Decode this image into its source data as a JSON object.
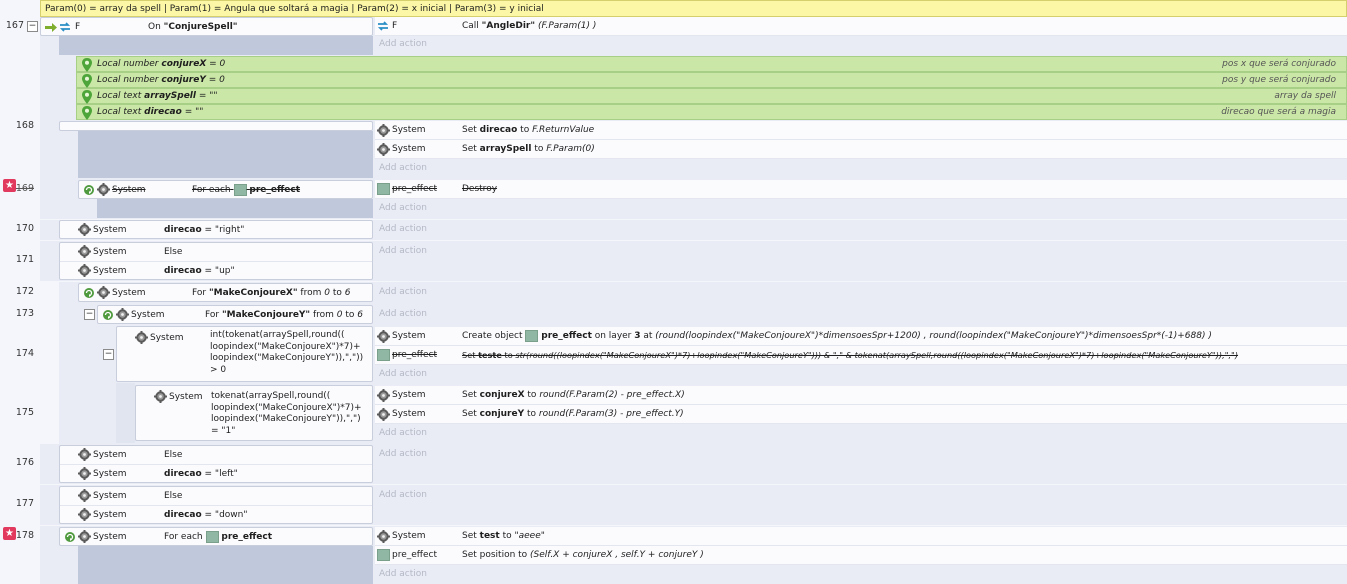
{
  "comment": "Param(0) = array da spell | Param(1) = Angula que soltará a magia | Param(2) = x inicial | Param(3) = y inicial",
  "add_action": "Add action",
  "rows": {
    "r167": {
      "num": "167",
      "cond_obj": "F",
      "cond_text": "On ",
      "cond_bold": "\"ConjureSpell\"",
      "act_obj": "F",
      "act_text": "Call ",
      "act_bold": "\"AngleDir\"",
      "act_rest": "(F.Param(1) )"
    },
    "locals": [
      {
        "kind": "Local number",
        "name": "conjureX",
        "value": " = 0",
        "note": "pos x que será conjurado"
      },
      {
        "kind": "Local number",
        "name": "conjureY",
        "value": " = 0",
        "note": "pos y que será conjurado"
      },
      {
        "kind": "Local text",
        "name": "arraySpell",
        "value": " = \"\"",
        "note": "array da spell"
      },
      {
        "kind": "Local text",
        "name": "direcao",
        "value": " = \"\"",
        "note": "direcao que será a magia"
      }
    ],
    "r168": {
      "num": "168",
      "a1_obj": "System",
      "a1_pre": "Set ",
      "a1_bold": "direcao",
      "a1_mid": " to ",
      "a1_it": "F.ReturnValue",
      "a2_obj": "System",
      "a2_pre": "Set ",
      "a2_bold": "arraySpell",
      "a2_mid": " to ",
      "a2_it": "F.Param(0)"
    },
    "r169": {
      "num": "169",
      "cond_obj": "System",
      "cond_text": "For each",
      "cond_bold": "pre_effect",
      "act_obj": "pre_effect",
      "act_text": "Destroy"
    },
    "r170": {
      "num": "170",
      "cond_obj": "System",
      "cond_bold": "direcao",
      "cond_text": " = \"right\""
    },
    "r171": {
      "num": "171",
      "c1_obj": "System",
      "c1_text": "Else",
      "c2_obj": "System",
      "c2_bold": "direcao",
      "c2_text": " = \"up\""
    },
    "r172": {
      "num": "172",
      "cond_obj": "System",
      "cond_pre": "For ",
      "cond_bold": "\"MakeConjoureX\"",
      "cond_mid": " from ",
      "cond_i1": "0",
      "cond_to": " to ",
      "cond_i2": "6"
    },
    "r173": {
      "num": "173",
      "cond_obj": "System",
      "cond_pre": "For ",
      "cond_bold": "\"MakeConjoureY\"",
      "cond_mid": " from ",
      "cond_i1": "0",
      "cond_to": " to ",
      "cond_i2": "6"
    },
    "r174": {
      "num": "174",
      "cond_obj": "System",
      "cond_lines": [
        "int(tokenat(arraySpell,round((",
        "loopindex(\"MakeConjoureX\")*7)+",
        "loopindex(\"MakeConjoureY\")),\",\"))",
        "> 0"
      ],
      "a1_obj": "System",
      "a1_pre": "Create object ",
      "a1_bold": "pre_effect",
      "a1_mid": " on layer ",
      "a1_layer": "3",
      "a1_at": " at ",
      "a1_expr": "(round(loopindex(\"MakeConjoureX\")*dimensoesSpr+1200)  , round(loopindex(\"MakeConjoureY\")*dimensoesSpr*(-1)+688)    )",
      "a2_obj": "pre_effect",
      "a2_pre": "Set ",
      "a2_bold": "teste",
      "a2_mid": " to ",
      "a2_it": "str(round((loopindex(\"MakeConjoureX\")*7)+loopindex(\"MakeConjoureY\"))) & \",\" & tokenat(arraySpell,round((loopindex(\"MakeConjoureX\")*7)+loopindex(\"MakeConjoureY\")),\",\")"
    },
    "r175": {
      "num": "175",
      "cond_obj": "System",
      "cond_lines": [
        "tokenat(arraySpell,round((",
        "loopindex(\"MakeConjoureX\")*7)+",
        "loopindex(\"MakeConjoureY\")),\",\")",
        "= \"1\""
      ],
      "a1_obj": "System",
      "a1_pre": "Set ",
      "a1_bold": "conjureX",
      "a1_mid": " to ",
      "a1_it": "round(F.Param(2) - pre_effect.X)",
      "a2_obj": "System",
      "a2_pre": "Set ",
      "a2_bold": "conjureY",
      "a2_mid": " to ",
      "a2_it": "round(F.Param(3) - pre_effect.Y)"
    },
    "r176": {
      "num": "176",
      "c1_obj": "System",
      "c1_text": "Else",
      "c2_obj": "System",
      "c2_bold": "direcao",
      "c2_text": " = \"left\""
    },
    "r177": {
      "num": "177",
      "c1_obj": "System",
      "c1_text": "Else",
      "c2_obj": "System",
      "c2_bold": "direcao",
      "c2_text": " = \"down\""
    },
    "r178": {
      "num": "178",
      "cond_obj": "System",
      "cond_text": "For each",
      "cond_bold": "pre_effect",
      "a1_obj": "System",
      "a1_pre": "Set ",
      "a1_bold": "test",
      "a1_mid": " to ",
      "a1_it": "\"aeee\"",
      "a2_obj": "pre_effect",
      "a2_pre": "Set position to ",
      "a2_it": "(Self.X + conjureX , self.Y + conjureY  )"
    }
  },
  "colors": {
    "variable_bg": "#cbe7a8",
    "comment_bg": "#fbf7a6",
    "bookmark": "#e23a5f",
    "indent_pad": "#c0c9dc",
    "sprite": "#8fb7a3"
  },
  "icons": [
    "arrow-right-icon",
    "trigger-icon",
    "gear-icon",
    "loop-icon",
    "sprite-icon",
    "variable-pin-icon",
    "bookmark-icon",
    "collapse-icon"
  ]
}
